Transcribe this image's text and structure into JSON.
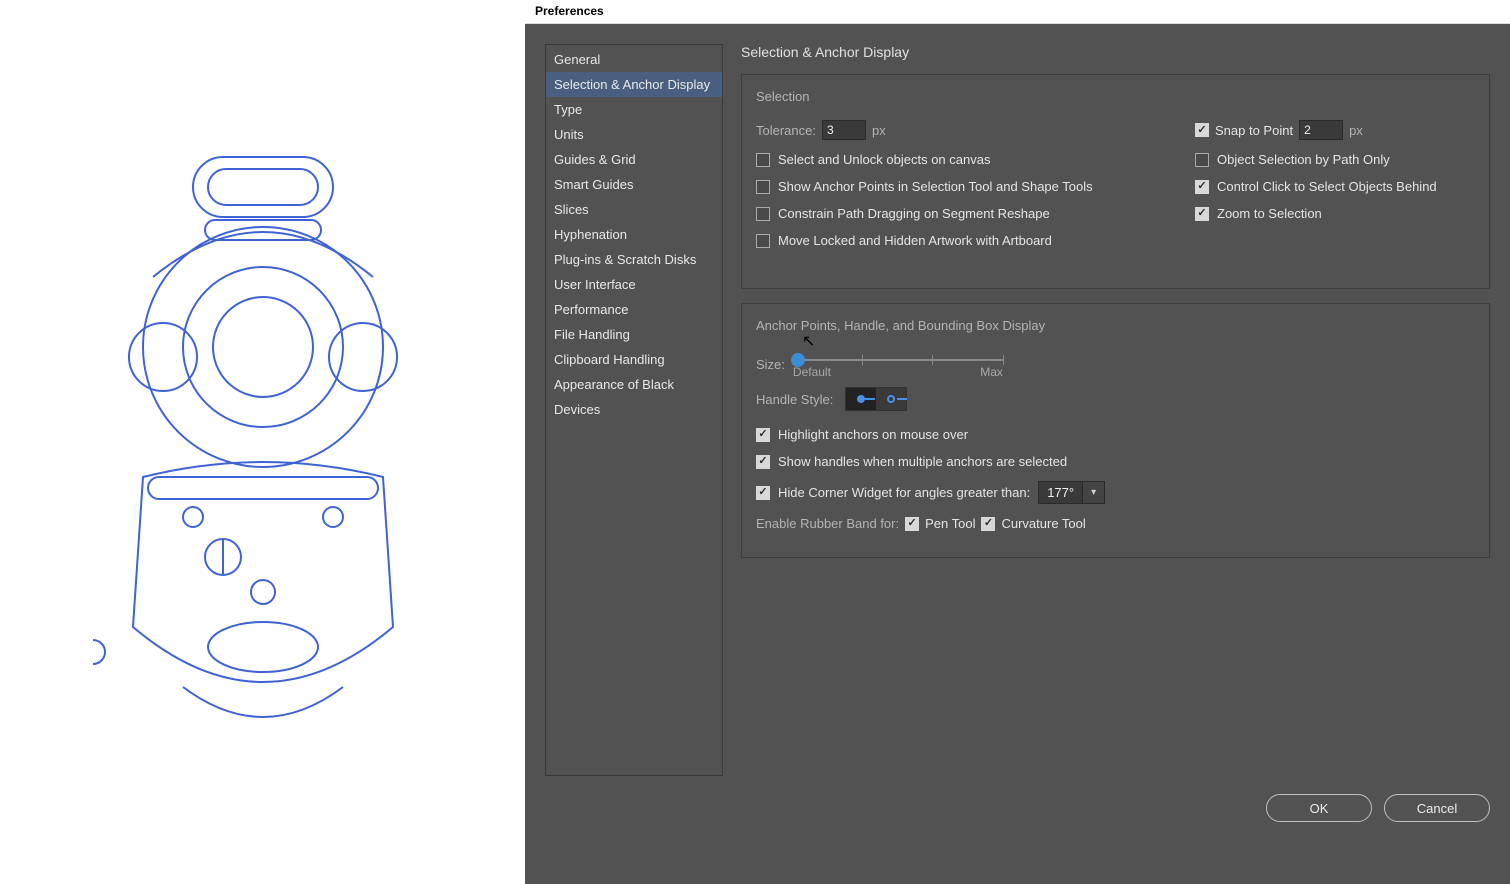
{
  "dialog": {
    "title": "Preferences"
  },
  "sidebar": {
    "items": [
      "General",
      "Selection & Anchor Display",
      "Type",
      "Units",
      "Guides & Grid",
      "Smart Guides",
      "Slices",
      "Hyphenation",
      "Plug-ins & Scratch Disks",
      "User Interface",
      "Performance",
      "File Handling",
      "Clipboard Handling",
      "Appearance of Black",
      "Devices"
    ],
    "active_index": 1
  },
  "content": {
    "title": "Selection & Anchor Display",
    "selection": {
      "title": "Selection",
      "tolerance_label": "Tolerance:",
      "tolerance_value": "3",
      "tolerance_unit": "px",
      "snap_label": "Snap to Point",
      "snap_value": "2",
      "snap_unit": "px",
      "snap_checked": true,
      "cb_left": [
        {
          "label": "Select and Unlock objects on canvas",
          "checked": false
        },
        {
          "label": "Show Anchor Points in Selection Tool and Shape Tools",
          "checked": false
        },
        {
          "label": "Constrain Path Dragging on Segment Reshape",
          "checked": false
        },
        {
          "label": "Move Locked and Hidden Artwork with Artboard",
          "checked": false
        }
      ],
      "cb_right": [
        {
          "label": "Object Selection by Path Only",
          "checked": false
        },
        {
          "label": "Control Click to Select Objects Behind",
          "checked": true
        },
        {
          "label": "Zoom to Selection",
          "checked": true
        }
      ]
    },
    "anchor": {
      "title": "Anchor Points, Handle, and Bounding Box Display",
      "size_label": "Size:",
      "slider_default": "Default",
      "slider_max": "Max",
      "handle_style_label": "Handle Style:",
      "cb_highlight": {
        "label": "Highlight anchors on mouse over",
        "checked": true
      },
      "cb_show_handles": {
        "label": "Show handles when multiple anchors are selected",
        "checked": true
      },
      "cb_hide_corner": {
        "label": "Hide Corner Widget for angles greater than:",
        "checked": true
      },
      "corner_angle": "177°",
      "rubber_band_label": "Enable Rubber Band for:",
      "rb_pen": {
        "label": "Pen Tool",
        "checked": true
      },
      "rb_curv": {
        "label": "Curvature Tool",
        "checked": true
      }
    }
  },
  "footer": {
    "ok": "OK",
    "cancel": "Cancel"
  }
}
